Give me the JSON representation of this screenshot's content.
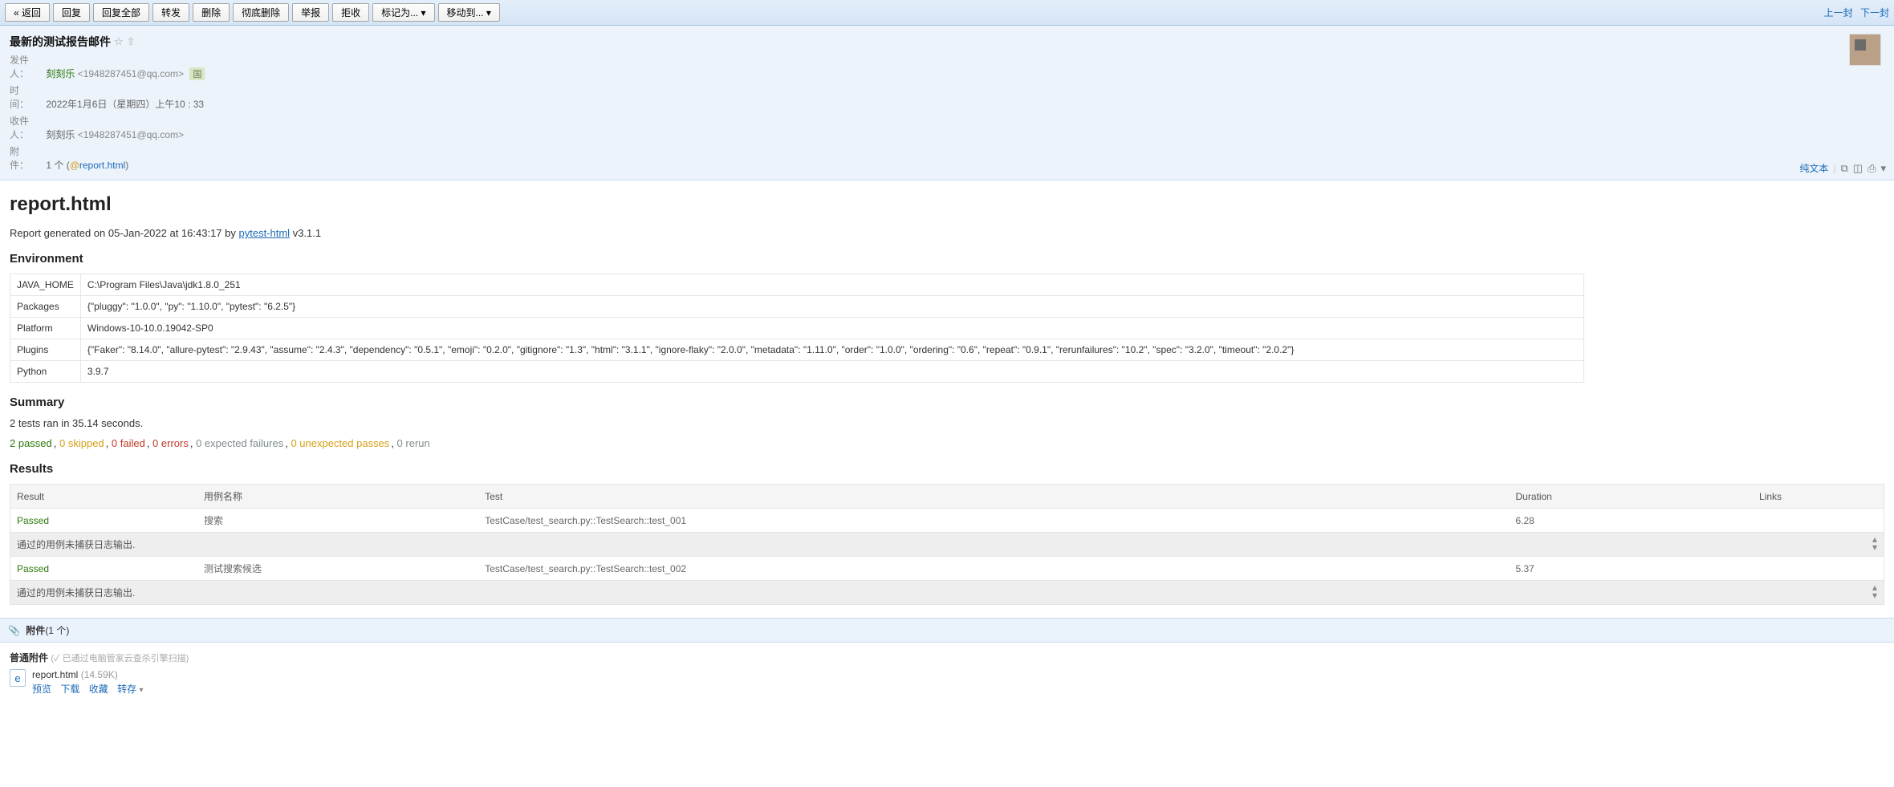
{
  "toolbar": {
    "back": "« 返回",
    "reply": "回复",
    "reply_all": "回复全部",
    "forward": "转发",
    "delete": "删除",
    "delete_full": "彻底删除",
    "report": "举报",
    "reject": "拒收",
    "mark_as": "标记为...",
    "move_to": "移动到...",
    "prev": "上一封",
    "next": "下一封"
  },
  "email": {
    "subject": "最新的测试报告邮件",
    "from_label": "发件人：",
    "from_name": "刻刻乐",
    "from_addr": "<1948287451@qq.com>",
    "from_badge": "国",
    "time_label": "时　间：",
    "time_value": "2022年1月6日（星期四）上午10 : 33",
    "to_label": "收件人：",
    "to_name": "刻刻乐",
    "to_addr": "<1948287451@qq.com>",
    "attach_label": "附　件：",
    "attach_count": "1 个",
    "attach_name": "report.html",
    "plain_text": "纯文本",
    "sep": "|"
  },
  "report": {
    "title": "report.html",
    "generated_prefix": "Report generated on 05-Jan-2022 at 16:43:17 by ",
    "generator": "pytest-html",
    "version_suffix": " v3.1.1",
    "env_heading": "Environment",
    "env_rows": [
      {
        "k": "JAVA_HOME",
        "v": "C:\\Program Files\\Java\\jdk1.8.0_251"
      },
      {
        "k": "Packages",
        "v": "{\"pluggy\": \"1.0.0\", \"py\": \"1.10.0\", \"pytest\": \"6.2.5\"}"
      },
      {
        "k": "Platform",
        "v": "Windows-10-10.0.19042-SP0"
      },
      {
        "k": "Plugins",
        "v": "{\"Faker\": \"8.14.0\", \"allure-pytest\": \"2.9.43\", \"assume\": \"2.4.3\", \"dependency\": \"0.5.1\", \"emoji\": \"0.2.0\", \"gitignore\": \"1.3\", \"html\": \"3.1.1\", \"ignore-flaky\": \"2.0.0\", \"metadata\": \"1.11.0\", \"order\": \"1.0.0\", \"ordering\": \"0.6\", \"repeat\": \"0.9.1\", \"rerunfailures\": \"10.2\", \"spec\": \"3.2.0\", \"timeout\": \"2.0.2\"}"
      },
      {
        "k": "Python",
        "v": "3.9.7"
      }
    ],
    "summary_heading": "Summary",
    "summary_text": "2 tests ran in 35.14 seconds.",
    "summary": {
      "passed": "2 passed",
      "skipped": "0 skipped",
      "failed": "0 failed",
      "errors": "0 errors",
      "expected": "0 expected failures",
      "unexpected": "0 unexpected passes",
      "rerun": "0 rerun"
    },
    "results_heading": "Results",
    "columns": {
      "result": "Result",
      "name": "用例名称",
      "test": "Test",
      "duration": "Duration",
      "links": "Links"
    },
    "rows": [
      {
        "result": "Passed",
        "name": "搜索",
        "test": "TestCase/test_search.py::TestSearch::test_001",
        "duration": "6.28",
        "links": "",
        "log": "通过的用例未捕获日志输出."
      },
      {
        "result": "Passed",
        "name": "测试搜索候选",
        "test": "TestCase/test_search.py::TestSearch::test_002",
        "duration": "5.37",
        "links": "",
        "log": "通过的用例未捕获日志输出."
      }
    ]
  },
  "attachments": {
    "section_title": "附件",
    "section_count": "(1 个)",
    "normal_label": "普通附件",
    "scan_note": "(✓ 已通过电脑管家云查杀引擎扫描)",
    "file_name": "report.html",
    "file_size": "(14.59K)",
    "preview": "预览",
    "download": "下载",
    "favorite": "收藏",
    "saveto": "转存"
  }
}
